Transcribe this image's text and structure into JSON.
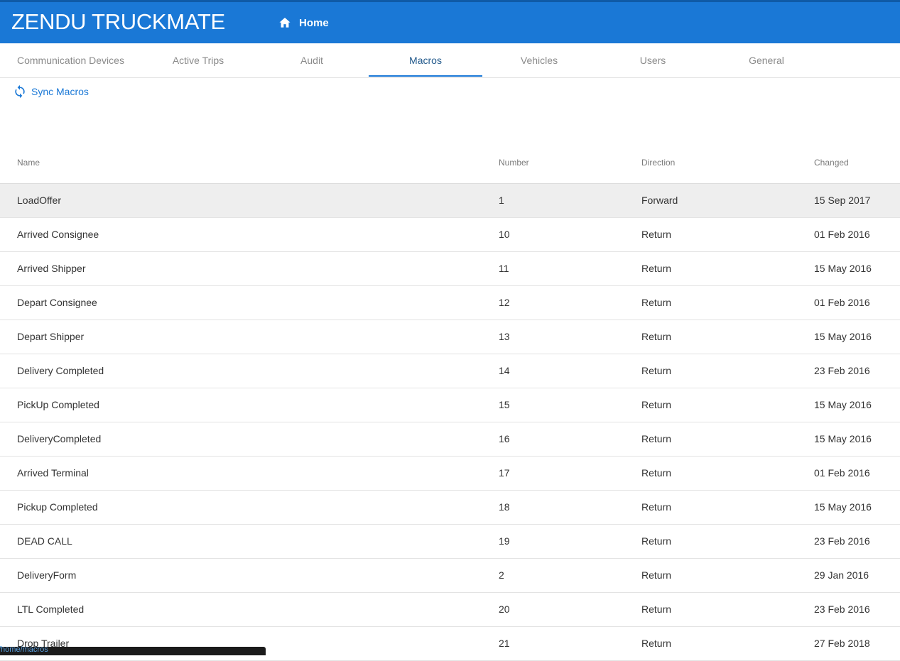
{
  "header": {
    "app_title": "ZENDU TRUCKMATE",
    "home_label": "Home"
  },
  "tabs": [
    {
      "label": "Communication Devices"
    },
    {
      "label": "Active Trips"
    },
    {
      "label": "Audit"
    },
    {
      "label": "Macros",
      "active": true
    },
    {
      "label": "Vehicles"
    },
    {
      "label": "Users"
    },
    {
      "label": "General"
    }
  ],
  "toolbar": {
    "sync_label": "Sync Macros"
  },
  "table": {
    "columns": {
      "name": "Name",
      "number": "Number",
      "direction": "Direction",
      "changed": "Changed"
    },
    "rows": [
      {
        "name": "LoadOffer",
        "number": "1",
        "direction": "Forward",
        "changed": "15 Sep 2017"
      },
      {
        "name": "Arrived Consignee",
        "number": "10",
        "direction": "Return",
        "changed": "01 Feb 2016"
      },
      {
        "name": "Arrived Shipper",
        "number": "11",
        "direction": "Return",
        "changed": "15 May 2016"
      },
      {
        "name": "Depart Consignee",
        "number": "12",
        "direction": "Return",
        "changed": "01 Feb 2016"
      },
      {
        "name": "Depart Shipper",
        "number": "13",
        "direction": "Return",
        "changed": "15 May 2016"
      },
      {
        "name": "Delivery Completed",
        "number": "14",
        "direction": "Return",
        "changed": "23 Feb 2016"
      },
      {
        "name": "PickUp Completed",
        "number": "15",
        "direction": "Return",
        "changed": "15 May 2016"
      },
      {
        "name": "DeliveryCompleted",
        "number": "16",
        "direction": "Return",
        "changed": "15 May 2016"
      },
      {
        "name": "Arrived Terminal",
        "number": "17",
        "direction": "Return",
        "changed": "01 Feb 2016"
      },
      {
        "name": "Pickup Completed",
        "number": "18",
        "direction": "Return",
        "changed": "15 May 2016"
      },
      {
        "name": "DEAD CALL",
        "number": "19",
        "direction": "Return",
        "changed": "23 Feb 2016"
      },
      {
        "name": "DeliveryForm",
        "number": "2",
        "direction": "Return",
        "changed": "29 Jan 2016"
      },
      {
        "name": "LTL Completed",
        "number": "20",
        "direction": "Return",
        "changed": "23 Feb 2016"
      },
      {
        "name": "Drop Trailer",
        "number": "21",
        "direction": "Return",
        "changed": "27 Feb 2018"
      }
    ]
  },
  "statusbar": {
    "url": "/home/macros"
  },
  "colors": {
    "header_bg": "#1a78d6",
    "accent": "#1a78d6",
    "selected_row": "#eeeeee"
  }
}
